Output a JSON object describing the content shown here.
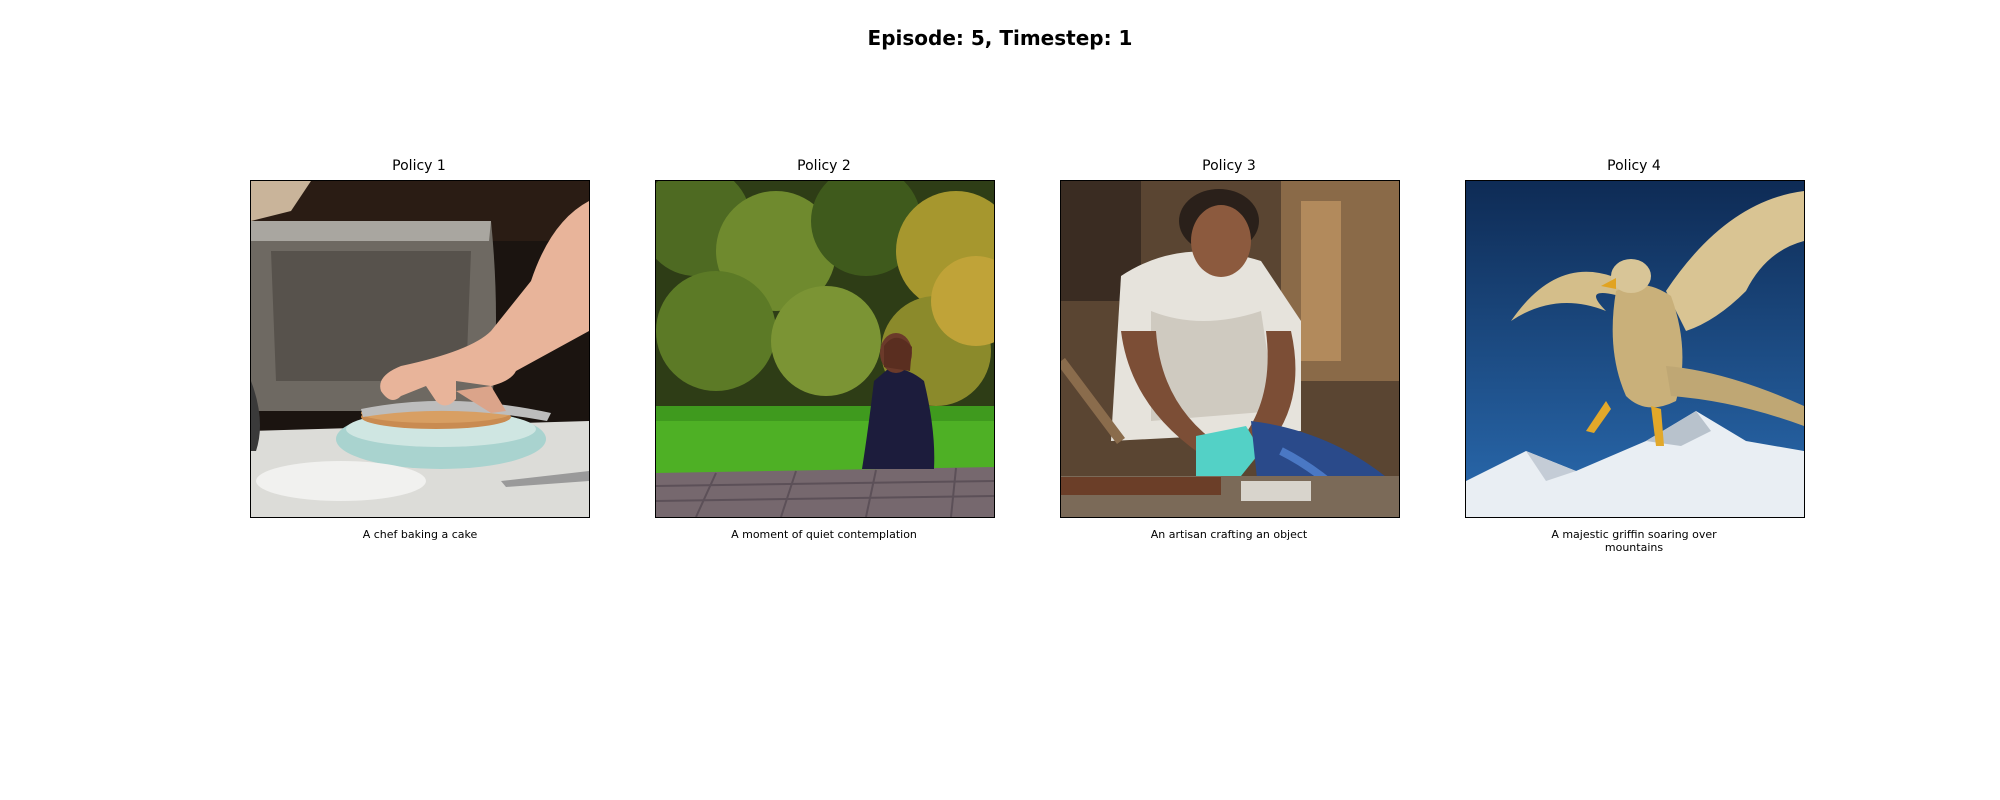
{
  "figure": {
    "title": "Episode: 5, Timestep: 1"
  },
  "panels": [
    {
      "title": "Policy 1",
      "caption": "A chef baking a cake",
      "image": "chef-baking-cake-photo"
    },
    {
      "title": "Policy 2",
      "caption": "A moment of quiet contemplation",
      "image": "woman-sitting-on-grass-photo"
    },
    {
      "title": "Policy 3",
      "caption": "An artisan crafting an object",
      "image": "artisan-working-photo"
    },
    {
      "title": "Policy 4",
      "caption": "A majestic griffin soaring over mountains",
      "image": "griffin-over-mountains-photo"
    }
  ]
}
